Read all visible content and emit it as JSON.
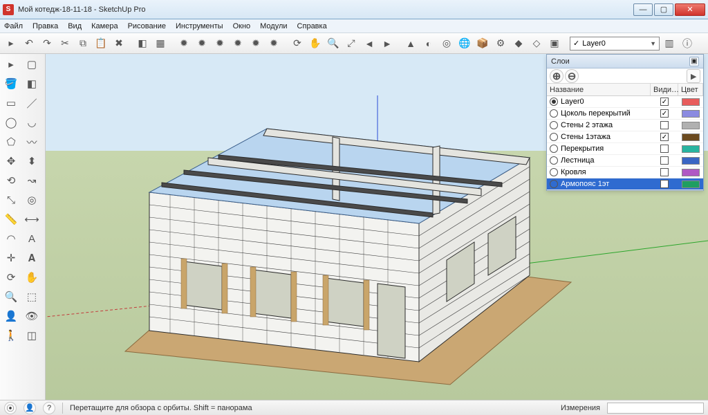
{
  "window": {
    "title": "Мой котедж-18-11-18 - SketchUp Pro",
    "app_icon_letter": "S"
  },
  "menu": [
    "Файл",
    "Правка",
    "Вид",
    "Камера",
    "Рисование",
    "Инструменты",
    "Окно",
    "Модули",
    "Справка"
  ],
  "toolbar_top": {
    "layer_selected": "Layer0"
  },
  "toolbar_top_icons": [
    {
      "name": "select-icon",
      "g": "▸"
    },
    {
      "name": "undo-icon",
      "g": "↶"
    },
    {
      "name": "redo-icon",
      "g": "↷"
    },
    {
      "name": "cut-icon",
      "g": "✂"
    },
    {
      "name": "copy-icon",
      "g": "⧉"
    },
    {
      "name": "paste-icon",
      "g": "📋"
    },
    {
      "name": "erase-icon",
      "g": "✖"
    },
    {
      "name": "sep"
    },
    {
      "name": "component-icon",
      "g": "◧"
    },
    {
      "name": "group-icon",
      "g": "▦"
    },
    {
      "name": "sep"
    },
    {
      "name": "fav1-icon",
      "g": "✹"
    },
    {
      "name": "fav2-icon",
      "g": "✹"
    },
    {
      "name": "fav3-icon",
      "g": "✹"
    },
    {
      "name": "fav4-icon",
      "g": "✹"
    },
    {
      "name": "fav5-icon",
      "g": "✹"
    },
    {
      "name": "fav6-icon",
      "g": "✹"
    },
    {
      "name": "sep"
    },
    {
      "name": "orbit-icon",
      "g": "⟳"
    },
    {
      "name": "pan-icon",
      "g": "✋"
    },
    {
      "name": "zoom-icon",
      "g": "🔍"
    },
    {
      "name": "zoomext-icon",
      "g": "⤢"
    },
    {
      "name": "prev-icon",
      "g": "◄"
    },
    {
      "name": "next-icon",
      "g": "►"
    },
    {
      "name": "sep"
    },
    {
      "name": "iso-icon",
      "g": "▲"
    },
    {
      "name": "shadow-icon",
      "g": "◐"
    },
    {
      "name": "xray-icon",
      "g": "◎"
    },
    {
      "name": "earth-icon",
      "g": "🌐"
    },
    {
      "name": "openbox-icon",
      "g": "📦"
    },
    {
      "name": "plugin-icon",
      "g": "⚙"
    },
    {
      "name": "extra1-icon",
      "g": "◆"
    },
    {
      "name": "extra2-icon",
      "g": "◇"
    },
    {
      "name": "extra3-icon",
      "g": "▣"
    }
  ],
  "left_tools": [
    {
      "name": "select-tool-icon",
      "g": "▸"
    },
    {
      "name": "component-tool-icon",
      "g": "▢"
    },
    {
      "name": "paint-tool-icon",
      "g": "🪣"
    },
    {
      "name": "eraser-tool-icon",
      "g": "◧"
    },
    {
      "name": "rectangle-tool-icon",
      "g": "▭"
    },
    {
      "name": "line-tool-icon",
      "g": "／"
    },
    {
      "name": "circle-tool-icon",
      "g": "◯"
    },
    {
      "name": "arc-tool-icon",
      "g": "◡"
    },
    {
      "name": "polygon-tool-icon",
      "g": "⬠"
    },
    {
      "name": "freehand-tool-icon",
      "g": "〰"
    },
    {
      "name": "move-tool-icon",
      "g": "✥"
    },
    {
      "name": "pushpull-tool-icon",
      "g": "⬍"
    },
    {
      "name": "rotate-tool-icon",
      "g": "⟲"
    },
    {
      "name": "followme-tool-icon",
      "g": "↝"
    },
    {
      "name": "scale-tool-icon",
      "g": "⤡"
    },
    {
      "name": "offset-tool-icon",
      "g": "◎"
    },
    {
      "name": "tape-tool-icon",
      "g": "📏"
    },
    {
      "name": "dimension-tool-icon",
      "g": "⟷"
    },
    {
      "name": "protractor-tool-icon",
      "g": "◠"
    },
    {
      "name": "text-tool-icon",
      "g": "A"
    },
    {
      "name": "axes-tool-icon",
      "g": "✛"
    },
    {
      "name": "3dtext-tool-icon",
      "g": "𝐀"
    },
    {
      "name": "orbit-tool-icon",
      "g": "⟳"
    },
    {
      "name": "pan-tool-icon",
      "g": "✋"
    },
    {
      "name": "zoom-tool-icon",
      "g": "🔍"
    },
    {
      "name": "zoomwin-tool-icon",
      "g": "⬚"
    },
    {
      "name": "position-tool-icon",
      "g": "👤"
    },
    {
      "name": "lookaround-tool-icon",
      "g": "👁"
    },
    {
      "name": "walk-tool-icon",
      "g": "🚶"
    },
    {
      "name": "section-tool-icon",
      "g": "◫"
    }
  ],
  "layers_panel": {
    "title": "Слои",
    "header": {
      "name": "Название",
      "visible": "Види…",
      "color": "Цвет"
    },
    "rows": [
      {
        "active": true,
        "name": "Layer0",
        "visible": true,
        "color": "#e85c5c"
      },
      {
        "active": false,
        "name": "Цоколь перекрытий",
        "visible": true,
        "color": "#8a8ae0"
      },
      {
        "active": false,
        "name": "Стены 2 этажа",
        "visible": false,
        "color": "#b0b0b0"
      },
      {
        "active": false,
        "name": "Стены 1этажа",
        "visible": true,
        "color": "#6b4a1f"
      },
      {
        "active": false,
        "name": "Перекрытия",
        "visible": false,
        "color": "#28b4a0"
      },
      {
        "active": false,
        "name": "Лестница",
        "visible": false,
        "color": "#3a66c4"
      },
      {
        "active": false,
        "name": "Кровля",
        "visible": false,
        "color": "#b058c4"
      },
      {
        "active": false,
        "name": "Армопояс 1эт",
        "visible": true,
        "color": "#1f9e60",
        "selected": true
      }
    ]
  },
  "status": {
    "hint": "Перетащите для обзора с орбиты.  Shift = панорама",
    "measure_label": "Измерения"
  }
}
